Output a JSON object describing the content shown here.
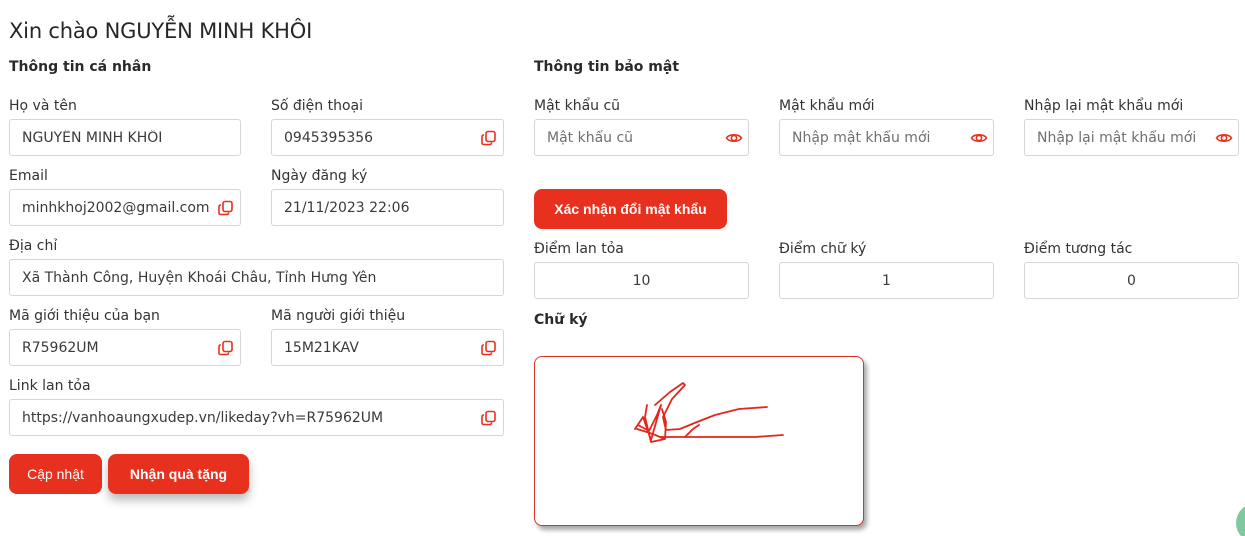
{
  "greeting": "Xin chào NGUYỄN MINH KHÔI",
  "personal": {
    "section_title": "Thông tin cá nhân",
    "name_label": "Họ và tên",
    "name_value": "NGUYỄN MINH KHÔI",
    "phone_label": "Số điện thoại",
    "phone_value": "0945395356",
    "email_label": "Email",
    "email_value": "minhkhoj2002@gmail.com",
    "reg_date_label": "Ngày đăng ký",
    "reg_date_value": "21/11/2023 22:06",
    "address_label": "Địa chỉ",
    "address_value": "Xã Thành Công, Huyện Khoái Châu, Tỉnh Hưng Yên",
    "my_code_label": "Mã giới thiệu của bạn",
    "my_code_value": "R75962UM",
    "referrer_label": "Mã người giới thiệu",
    "referrer_value": "15M21KAV",
    "link_label": "Link lan tỏa",
    "link_value": "https://vanhoaungxudep.vn/likeday?vh=R75962UM",
    "update_button": "Cập nhật",
    "gift_button": "Nhận quà tặng"
  },
  "security": {
    "section_title": "Thông tin bảo mật",
    "old_pw_label": "Mật khẩu cũ",
    "old_pw_placeholder": "Mật khẩu cũ",
    "new_pw_label": "Mật khẩu mới",
    "new_pw_placeholder": "Nhập mật khẩu mới",
    "confirm_pw_label": "Nhập lại mật khẩu mới",
    "confirm_pw_placeholder": "Nhập lại mật khẩu mới",
    "confirm_button": "Xác nhận đổi mật khẩu"
  },
  "points": {
    "spread_label": "Điểm lan tỏa",
    "spread_value": "10",
    "signature_label": "Điểm chữ ký",
    "signature_value": "1",
    "interaction_label": "Điểm tương tác",
    "interaction_value": "0"
  },
  "signature": {
    "title": "Chữ ký"
  },
  "colors": {
    "accent": "#e8301f",
    "text": "#2b2b2b",
    "border": "#d6d6d6",
    "icon": "#e8301f"
  },
  "icons": {
    "copy": "copy-icon",
    "eye": "eye-icon"
  }
}
